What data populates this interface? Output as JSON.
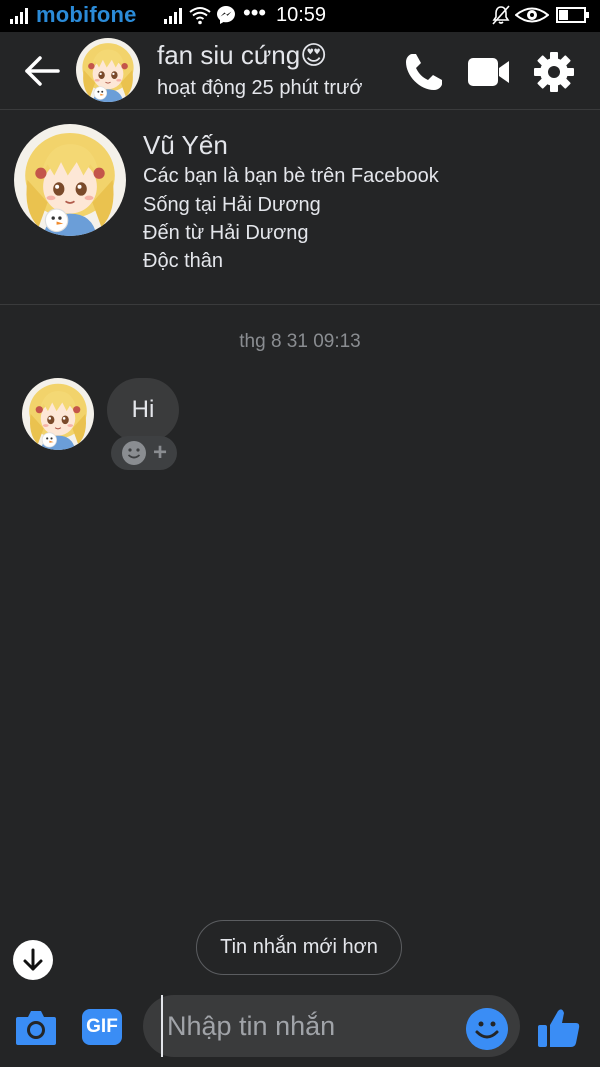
{
  "status_bar": {
    "carrier": "mobifone",
    "time": "10:59",
    "overflow": "•••",
    "icons": [
      "signal-icon",
      "wifi-icon",
      "messenger-icon",
      "mute-bell-icon",
      "eye-icon",
      "battery-icon"
    ]
  },
  "header": {
    "name": "fan siu cứng😍",
    "status": "hoạt động 25 phút trướ",
    "icons": [
      "back-arrow-icon",
      "phone-icon",
      "video-camera-icon",
      "gear-icon"
    ]
  },
  "profile": {
    "name": "Vũ Yến",
    "lines": [
      "Các bạn là bạn bè trên Facebook",
      "Sống tại Hải Dương",
      "Đến từ Hải Dương",
      "Độc thân"
    ]
  },
  "conversation": {
    "timestamp": "thg 8 31 09:13",
    "messages": [
      {
        "text": "Hi"
      }
    ],
    "reaction_plus": "+"
  },
  "newer_messages_label": "Tin nhắn mới hơn",
  "composer": {
    "gif_label": "GIF",
    "placeholder": "Nhập tin nhắn",
    "value": ""
  },
  "colors": {
    "background": "#242526",
    "accent": "#3a8df5",
    "bubble": "#3a3b3c",
    "text": "#e4e6eb",
    "muted": "#8a8d91"
  }
}
